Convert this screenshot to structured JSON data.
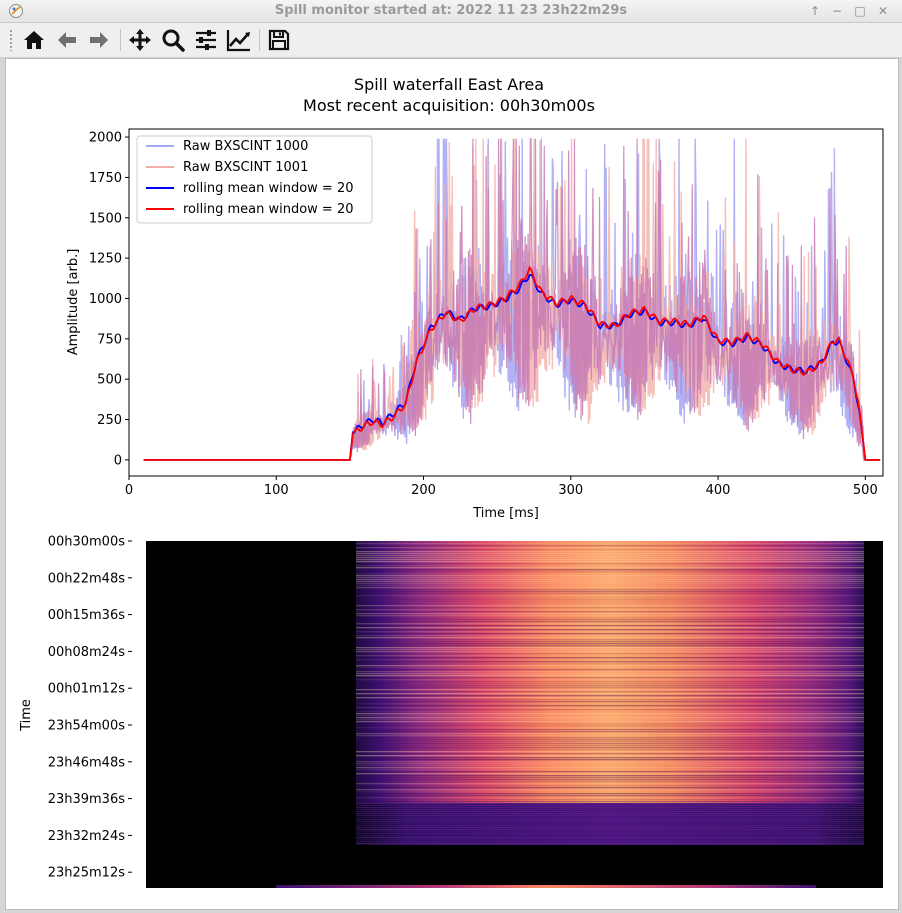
{
  "window": {
    "title": "Spill monitor started at: 2022 11 23 23h22m29s",
    "controls": [
      "↑",
      "−",
      "□",
      "✕"
    ]
  },
  "toolbar": {
    "buttons": [
      {
        "id": "home",
        "icon": "home-icon"
      },
      {
        "id": "back",
        "icon": "arrow-left-icon"
      },
      {
        "id": "forward",
        "icon": "arrow-right-icon"
      },
      {
        "id": "pan",
        "icon": "move-icon"
      },
      {
        "id": "zoom",
        "icon": "magnifier-icon"
      },
      {
        "id": "subplots",
        "icon": "sliders-icon"
      },
      {
        "id": "edit-axes",
        "icon": "chart-line-icon"
      },
      {
        "id": "save",
        "icon": "floppy-disk-icon"
      }
    ]
  },
  "colors": {
    "raw1": "#a8a8f2",
    "raw2": "#f2b0a8",
    "overlap": "#c87bb4",
    "mean1": "#0000ff",
    "mean2": "#ff0000"
  },
  "figure": {
    "title_line1": "Spill waterfall East Area",
    "title_line2": "Most recent acquisition: 00h30m00s"
  },
  "chart_data": [
    {
      "type": "line",
      "xlabel": "Time [ms]",
      "ylabel": "Amplitude [arb.]",
      "xlim": [
        0,
        512
      ],
      "ylim": [
        -100,
        2050
      ],
      "xticks": [
        0,
        100,
        200,
        300,
        400,
        500
      ],
      "yticks": [
        0,
        250,
        500,
        750,
        1000,
        1250,
        1500,
        1750,
        2000
      ],
      "legend_position": "top-left",
      "series": [
        {
          "name": "Raw BXSCINT 1000",
          "color": "#a8a8f2",
          "style": "raw"
        },
        {
          "name": "Raw BXSCINT 1001",
          "color": "#f2b0a8",
          "style": "raw"
        },
        {
          "name": "rolling mean window = 20",
          "color": "#0000ff",
          "style": "mean",
          "x": [
            10,
            150,
            152,
            158,
            165,
            172,
            180,
            188,
            195,
            205,
            215,
            225,
            235,
            245,
            255,
            265,
            272,
            280,
            290,
            300,
            310,
            320,
            330,
            340,
            350,
            360,
            370,
            380,
            390,
            400,
            410,
            420,
            430,
            440,
            450,
            460,
            470,
            478,
            482,
            488,
            492,
            496,
            500,
            510
          ],
          "y": [
            0,
            0,
            170,
            210,
            250,
            230,
            290,
            360,
            610,
            820,
            920,
            870,
            940,
            950,
            990,
            1060,
            1150,
            1030,
            960,
            990,
            950,
            830,
            830,
            900,
            920,
            850,
            850,
            830,
            880,
            730,
            720,
            760,
            710,
            600,
            560,
            550,
            600,
            730,
            730,
            600,
            500,
            300,
            0,
            0
          ]
        },
        {
          "name": "rolling mean window = 20",
          "color": "#ff0000",
          "style": "mean",
          "x": [
            10,
            150,
            152,
            158,
            165,
            172,
            180,
            188,
            195,
            205,
            215,
            225,
            235,
            245,
            255,
            265,
            272,
            280,
            290,
            300,
            310,
            320,
            330,
            340,
            350,
            360,
            370,
            380,
            390,
            400,
            410,
            420,
            430,
            440,
            450,
            460,
            470,
            478,
            482,
            488,
            492,
            496,
            500,
            510
          ],
          "y": [
            0,
            0,
            160,
            200,
            235,
            220,
            270,
            350,
            600,
            810,
            910,
            860,
            940,
            960,
            1000,
            1080,
            1180,
            1040,
            970,
            1000,
            960,
            840,
            830,
            910,
            930,
            860,
            860,
            840,
            890,
            740,
            730,
            770,
            720,
            610,
            560,
            540,
            600,
            740,
            740,
            610,
            510,
            310,
            0,
            0
          ]
        }
      ]
    },
    {
      "type": "heatmap",
      "ylabel": "Time",
      "yticks": [
        "00h30m00s",
        "00h22m48s",
        "00h15m36s",
        "00h08m24s",
        "00h01m12s",
        "23h54m00s",
        "23h46m48s",
        "23h39m36s",
        "23h32m24s",
        "23h25m12s"
      ],
      "xlim": [
        0,
        512
      ],
      "colormap": "magma"
    }
  ]
}
